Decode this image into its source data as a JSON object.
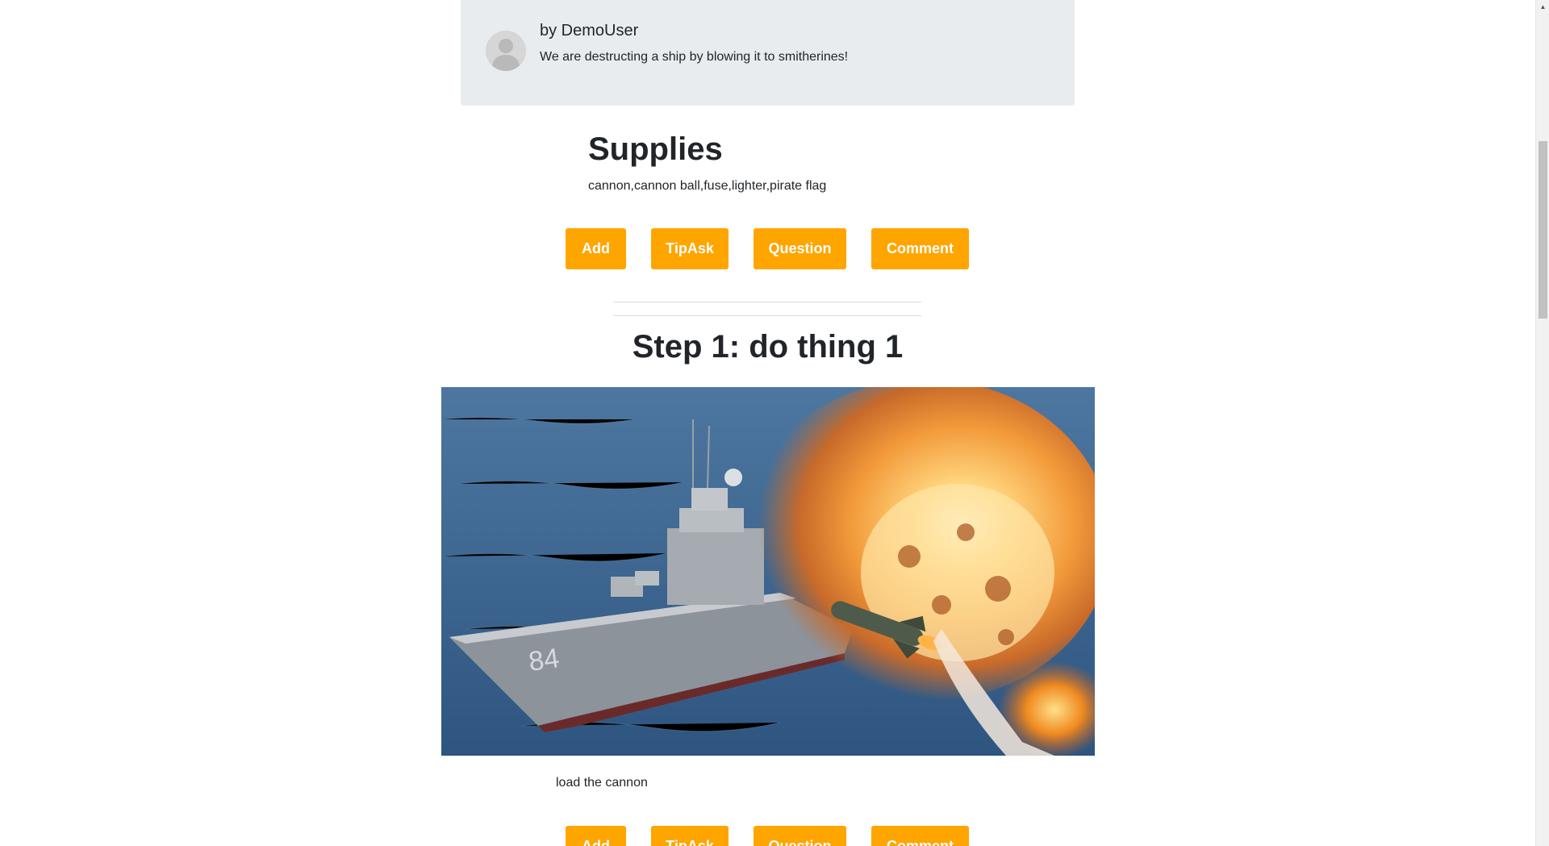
{
  "author": {
    "name": "by DemoUser",
    "description": "We are destructing a ship by blowing it to smitherines!"
  },
  "supplies": {
    "title": "Supplies",
    "list": "cannon,cannon ball,fuse,lighter,pirate flag"
  },
  "actions": {
    "add": "Add",
    "tip": "TipAsk",
    "question": "Question",
    "comment": "Comment"
  },
  "step": {
    "title": "Step 1: do thing 1",
    "description": "load the cannon",
    "image_alt": "warship-explosion-image"
  },
  "colors": {
    "button_bg": "#ffa500",
    "card_bg": "#e9ecef"
  }
}
